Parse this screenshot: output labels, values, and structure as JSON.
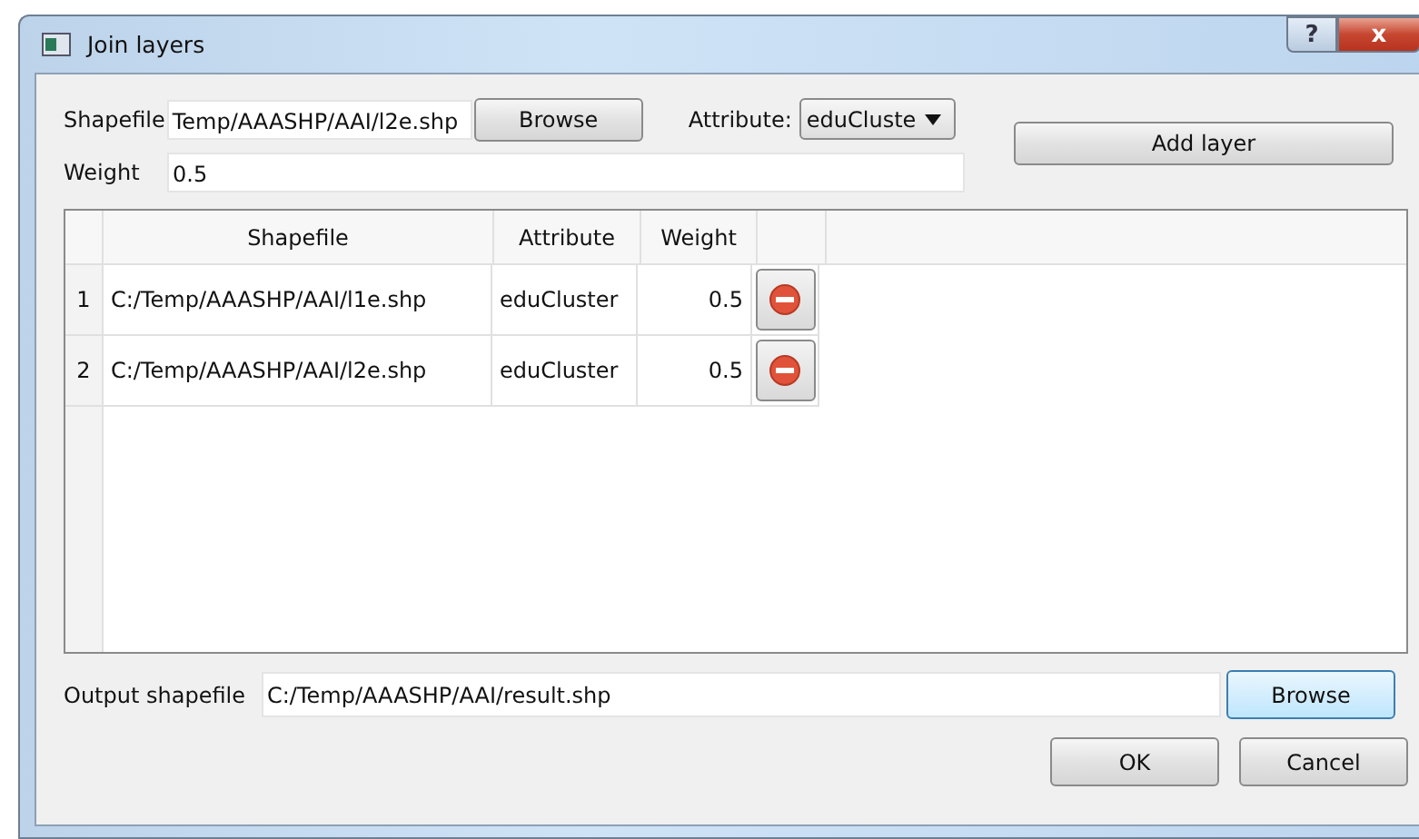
{
  "window": {
    "title": "Join layers",
    "buttons": [
      {
        "kind": "help",
        "label": "?"
      },
      {
        "kind": "close",
        "label": "x"
      }
    ]
  },
  "input": {
    "shapefile_label": "Shapefile",
    "shapefile_value": "Temp/AAASHP/AAI/l2e.shp",
    "browse": "Browse",
    "attribute_label": "Attribute:",
    "attribute_value": "eduCluste",
    "add_button": "Add layer",
    "weight_label": "Weight",
    "weight_value": "0.5"
  },
  "table": {
    "columns": [
      "Shapefile",
      "Attribute",
      "Weight"
    ],
    "rows": [
      {
        "index": "1",
        "shapefile": "C:/Temp/AAASHP/AAI/l1e.shp",
        "attribute": "eduCluster",
        "weight": "0.5"
      },
      {
        "index": "2",
        "shapefile": "C:/Temp/AAASHP/AAI/l2e.shp",
        "attribute": "eduCluster",
        "weight": "0.5"
      }
    ]
  },
  "output": {
    "label": "Output shapefile",
    "value": "C:/Temp/AAASHP/AAI/result.shp",
    "browse": "Browse"
  },
  "buttons": [
    "OK",
    "Cancel"
  ]
}
